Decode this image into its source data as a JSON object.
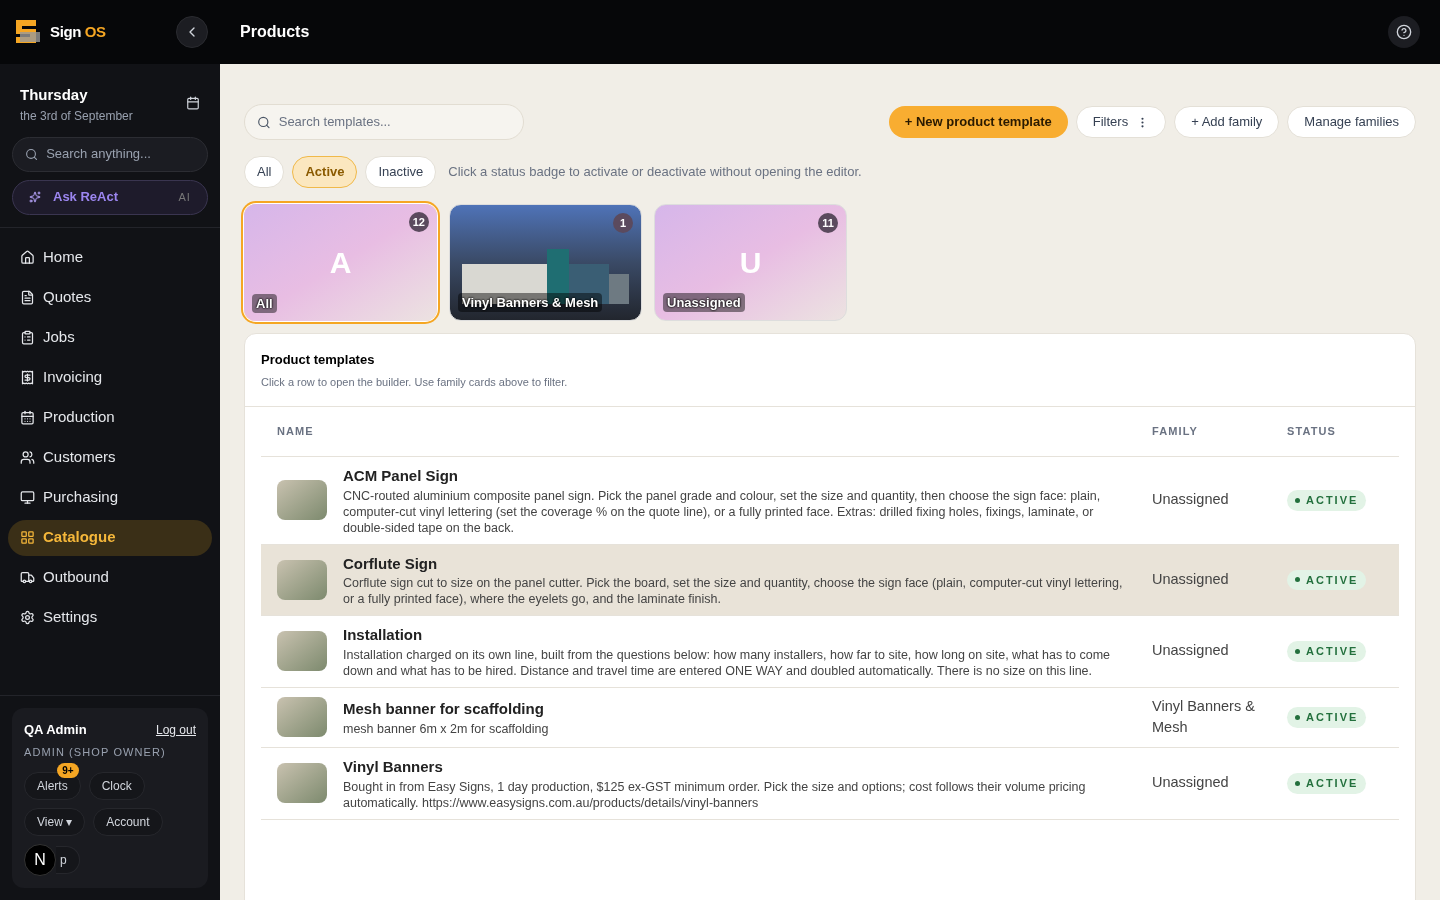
{
  "brand": {
    "name": "Sign",
    "accent": "OS"
  },
  "date": {
    "day": "Thursday",
    "date": "the 3rd of September"
  },
  "sidebar_search": {
    "placeholder": "Search anything..."
  },
  "ask": {
    "label": "Ask ReAct",
    "tag": "AI"
  },
  "nav": [
    {
      "label": "Home",
      "selected": false
    },
    {
      "label": "Quotes",
      "selected": false
    },
    {
      "label": "Jobs",
      "selected": false
    },
    {
      "label": "Invoicing",
      "selected": false
    },
    {
      "label": "Production",
      "selected": false
    },
    {
      "label": "Customers",
      "selected": false
    },
    {
      "label": "Purchasing",
      "selected": false
    },
    {
      "label": "Catalogue",
      "selected": true
    },
    {
      "label": "Outbound",
      "selected": false
    },
    {
      "label": "Settings",
      "selected": false
    }
  ],
  "user": {
    "name": "QA Admin",
    "logout": "Log out",
    "role": "ADMIN (SHOP OWNER)",
    "buttons": [
      {
        "label": "Alerts",
        "badge": "9+"
      },
      {
        "label": "Clock"
      },
      {
        "label": "View ▾"
      },
      {
        "label": "Account"
      },
      {
        "label": "p"
      }
    ],
    "avatar": "N"
  },
  "page_title": "Products",
  "search": {
    "placeholder": "Search templates..."
  },
  "actions": [
    {
      "label": "+ New product template",
      "kind": "primary"
    },
    {
      "label": "Filters",
      "kind": "menu"
    },
    {
      "label": "+ Add family",
      "kind": "plain"
    },
    {
      "label": "Manage families",
      "kind": "plain"
    }
  ],
  "status_filters": [
    {
      "label": "All",
      "selected": false
    },
    {
      "label": "Active",
      "selected": true
    },
    {
      "label": "Inactive",
      "selected": false
    }
  ],
  "status_hint": "Click a status badge to activate or deactivate without opening the editor.",
  "families": [
    {
      "kind": "letter",
      "letter": "A",
      "label": "All",
      "count": "12",
      "selected": true
    },
    {
      "kind": "photo",
      "label": "Vinyl Banners & Mesh",
      "count": "1",
      "selected": false
    },
    {
      "kind": "letter",
      "letter": "U",
      "label": "Unassigned",
      "count": "11",
      "selected": false
    }
  ],
  "templates": {
    "title": "Product templates",
    "subtitle": "Click a row to open the builder. Use family cards above to filter.",
    "columns": [
      "NAME",
      "FAMILY",
      "STATUS"
    ],
    "rows": [
      {
        "name": "ACM Panel Sign",
        "description": "CNC-routed aluminium composite panel sign. Pick the panel grade and colour, set the size and quantity, then choose the sign face: plain, computer-cut vinyl lettering (set the coverage % on the quote line), or a fully printed face. Extras: drilled fixing holes, fixings, laminate, or double-sided tape on the back.",
        "family": "Unassigned",
        "status": "ACTIVE",
        "selected": false
      },
      {
        "name": "Corflute Sign",
        "description": "Corflute sign cut to size on the panel cutter. Pick the board, set the size and quantity, choose the sign face (plain, computer-cut vinyl lettering, or a fully printed face), where the eyelets go, and the laminate finish.",
        "family": "Unassigned",
        "status": "ACTIVE",
        "selected": true
      },
      {
        "name": "Installation",
        "description": "Installation charged on its own line, built from the questions below: how many installers, how far to site, how long on site, what has to come down and what has to be hired. Distance and travel time are entered ONE WAY and doubled automatically. There is no size on this line.",
        "family": "Unassigned",
        "status": "ACTIVE",
        "selected": false
      },
      {
        "name": "Mesh banner for scaffolding",
        "description": "mesh banner 6m x 2m for scaffolding",
        "family": "Vinyl Banners & Mesh",
        "status": "ACTIVE",
        "selected": false
      },
      {
        "name": "Vinyl Banners",
        "description": "Bought in from Easy Signs, 1 day production, $125 ex-GST minimum order. Pick the size and options; cost follows their volume pricing automatically. https://www.easysigns.com.au/products/details/vinyl-banners",
        "family": "Unassigned",
        "status": "ACTIVE",
        "selected": false
      }
    ]
  }
}
